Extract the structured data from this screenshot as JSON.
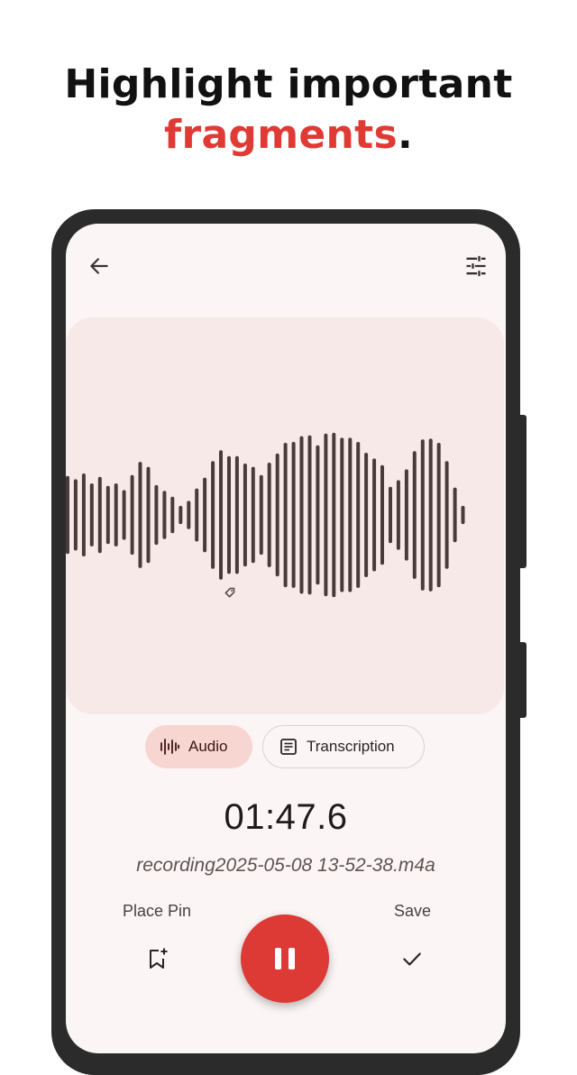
{
  "headline": {
    "line1": "Highlight important",
    "line2_accent": "fragments",
    "line2_tail": "."
  },
  "colors": {
    "accent": "#e03a35",
    "waveform_bar": "#4a3b3b",
    "panel_bg": "#f6e9e7",
    "audio_tab_bg": "#f7d5d1",
    "fab": "#dd3a35"
  },
  "toolbar": {
    "back_icon": "arrow-left-icon",
    "settings_icon": "sliders-icon"
  },
  "waveform": {
    "levels": [
      0.47,
      0.43,
      0.5,
      0.38,
      0.46,
      0.35,
      0.38,
      0.3,
      0.48,
      0.64,
      0.58,
      0.36,
      0.29,
      0.22,
      0.11,
      0.17,
      0.32,
      0.45,
      0.65,
      0.78,
      0.71,
      0.71,
      0.62,
      0.58,
      0.48,
      0.63,
      0.74,
      0.87,
      0.88,
      0.95,
      0.96,
      0.84,
      0.98,
      0.99,
      0.93,
      0.93,
      0.88,
      0.75,
      0.68,
      0.6,
      0.34,
      0.42,
      0.55,
      0.77,
      0.91,
      0.92,
      0.87,
      0.65,
      0.33,
      0.11
    ],
    "pin_icon": "tag-icon"
  },
  "tabs": {
    "audio": {
      "label": "Audio",
      "icon": "waveform-icon",
      "selected": true
    },
    "transcription": {
      "label": "Transcription",
      "icon": "document-icon",
      "selected": false
    }
  },
  "recording": {
    "time": "01:47.6",
    "filename": "recording2025-05-08 13-52-38.m4a"
  },
  "controls": {
    "place_pin_label": "Place Pin",
    "place_pin_icon": "bookmark-add-icon",
    "pause_icon": "pause-icon",
    "save_label": "Save",
    "save_icon": "check-icon"
  }
}
